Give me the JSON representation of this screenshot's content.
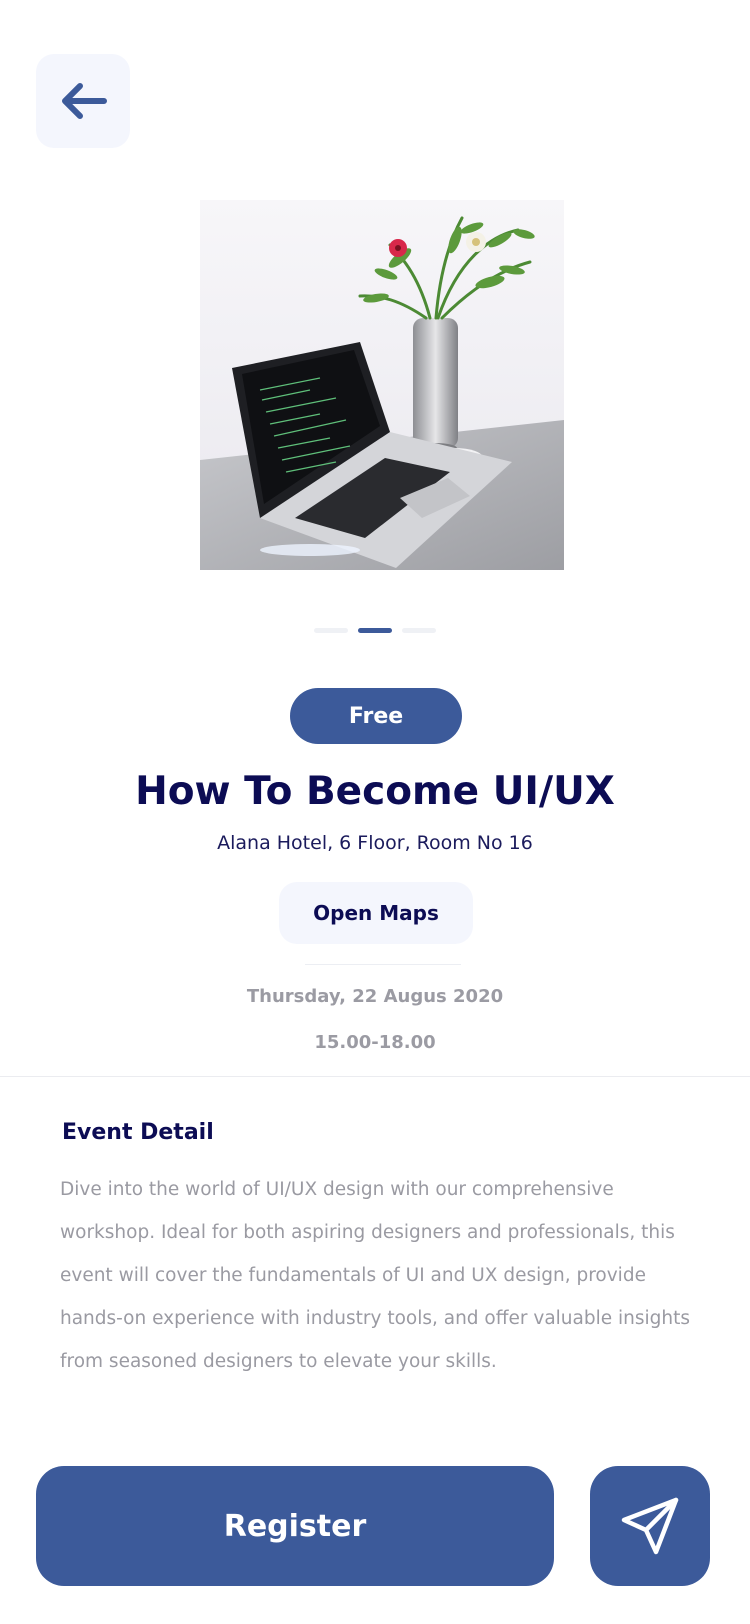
{
  "header": {
    "back_icon": "arrow-left-icon"
  },
  "carousel": {
    "image": "laptop-on-desk-with-flower-vase",
    "page_count": 3,
    "active_index": 1
  },
  "event": {
    "price_badge": "Free",
    "title": "How To Become UI/UX",
    "location": "Alana Hotel, 6 Floor, Room No 16",
    "open_maps_label": "Open Maps",
    "date": "Thursday, 22 Augus 2020",
    "time": "15.00-18.00"
  },
  "detail": {
    "heading": "Event Detail",
    "description": "Dive into the world of UI/UX design with our comprehensive workshop. Ideal for both aspiring designers and professionals, this event will cover the fundamentals of UI and UX design, provide hands-on experience with industry tools, and offer valuable insights from seasoned designers to elevate your skills."
  },
  "actions": {
    "register_label": "Register",
    "share_icon": "send-icon"
  },
  "colors": {
    "accent": "#3c5a9a",
    "title_text": "#0c0c54",
    "muted_text": "#9a9aa2",
    "soft_background": "#f4f6fd"
  }
}
